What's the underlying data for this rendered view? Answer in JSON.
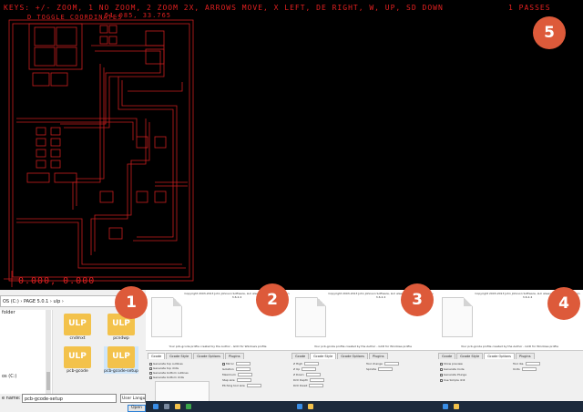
{
  "viewer": {
    "keys_help": "KEYS: +/- ZOOM, 1 NO ZOOM, 2 ZOOM 2X, ARROWS MOVE, X LEFT, DE RIGHT, W, UP, SD DOWN",
    "toggle": "D TOGGLE COORDINATES",
    "coords": "51.085, 33.765",
    "passes": "1 PASSES",
    "origin": "0.000, 0.000",
    "trace_color": "#c81e1e"
  },
  "badges": {
    "b1": "1",
    "b2": "2",
    "b3": "3",
    "b4": "4",
    "b5": "5"
  },
  "file_dialog": {
    "path": "OS (C:) › PAGE 5.0.1 › ulp ›",
    "folder_label": "folder",
    "drive_label": "os (C:)",
    "files": [
      {
        "icon_text": "ULP",
        "name": "cndmxt"
      },
      {
        "icon_text": "ULP",
        "name": "pcndwp"
      },
      {
        "icon_text": "ULP",
        "name": "pcb-gcode"
      },
      {
        "icon_text": "ULP",
        "name": "pcb-gcode-setup"
      }
    ],
    "name_label": "e name:",
    "name_value": "pcb-gcode-setup",
    "filter": "User Language",
    "open_label": "Open"
  },
  "gcode_dialogs": {
    "copyright": "Copyright 2003-2013 John Johnson Software, LLC\nwww.pcbgcode.org\nVersion 3.6.2.4",
    "thanks": "Your pcb-gcode profile created by the Author - GCD for Windows profile",
    "tabs": [
      "Gcode",
      "Gcode Style",
      "Gcode Options",
      "Plugins"
    ],
    "panel2_rows": [
      "Generate top outlines",
      "Generate top drills",
      "Generate bottom outlines",
      "Generate bottom drills",
      "Mirror",
      "Isolation",
      "Maximum",
      "Step size",
      "Etching tool size"
    ],
    "panel3_rows": [
      "Z High",
      "Z Up",
      "Z Down",
      "Drill Depth",
      "Drill Dwell",
      "Tool change",
      "Spindle"
    ],
    "panel4_rows": [
      "Show preview",
      "Generate Code",
      "Generate Plunge",
      "Use Simple drill",
      "Tool dia.",
      "Units"
    ]
  }
}
